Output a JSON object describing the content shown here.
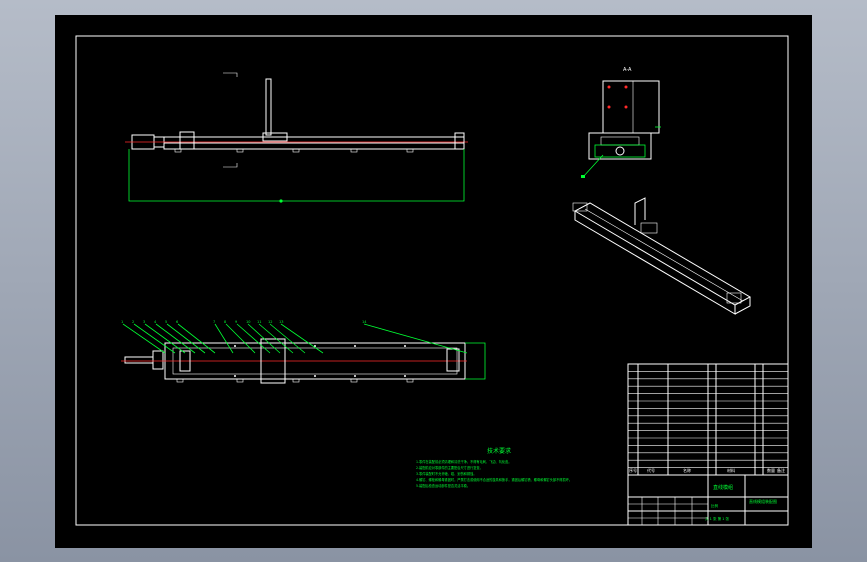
{
  "drawing": {
    "colors": {
      "sheet": "#000000",
      "lines": "#ffffff",
      "dimensions": "#00ff33",
      "centerlines": "#ff2a2a"
    },
    "balloons": [
      "1",
      "2",
      "3",
      "4",
      "5",
      "6",
      "7",
      "8",
      "9",
      "10",
      "11",
      "12",
      "13",
      "14"
    ],
    "tech_title": "技术要求",
    "tech_lines": [
      "1.零件在装配前必须清理和清洗干净，不得有毛刺、飞边、氧化皮。",
      "2.装配前应对零部件的主要配合尺寸进行复查。",
      "3.零件装配时不允许磕、碰、划伤和锈蚀。",
      "4.螺钉、螺栓和螺母紧固时，严禁打击或使用不合适的旋具和扳手，紧固后螺钉槽、螺母和螺钉头部不得损坏。",
      "5.装配后检查运动部件是否灵活平稳。"
    ],
    "title_block": {
      "col_seq": "序号",
      "col_code": "代号",
      "col_name": "名称",
      "col_qty": "数量",
      "col_material": "材料",
      "col_note": "备注",
      "product_name": "直线模组",
      "drawing_name": "直线模组装配图",
      "scale_label": "比例",
      "sheet_info": "共 1 张 第 1 张"
    }
  }
}
